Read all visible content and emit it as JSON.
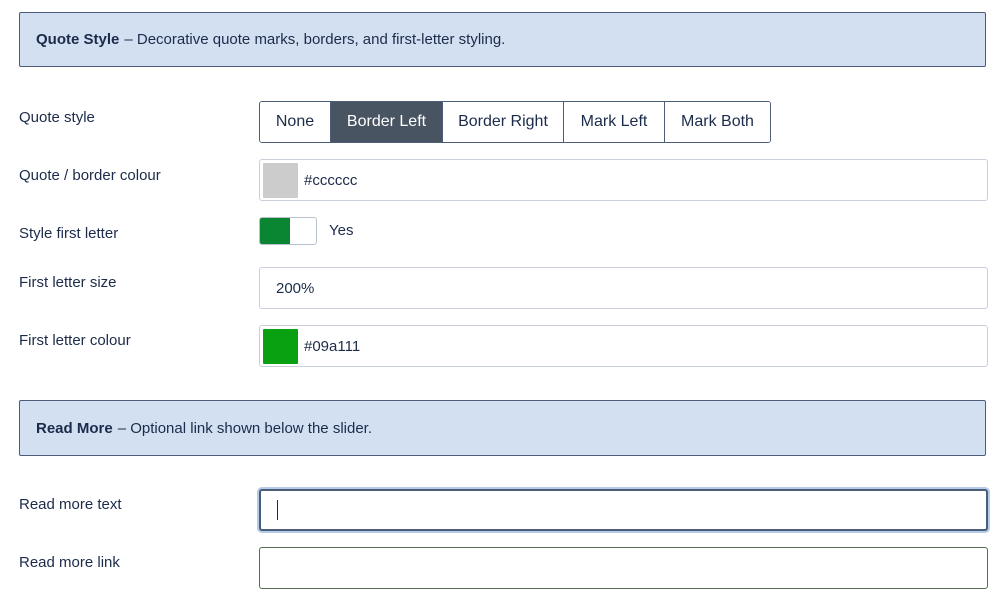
{
  "quote_section": {
    "title": "Quote Style",
    "description": "– Decorative quote marks, borders, and first-letter styling."
  },
  "quote_style": {
    "label": "Quote style",
    "options": [
      "None",
      "Border Left",
      "Border Right",
      "Mark Left",
      "Mark Both"
    ],
    "selected": "Border Left"
  },
  "border_colour": {
    "label": "Quote / border colour",
    "value": "#cccccc",
    "swatch": "#cccccc"
  },
  "first_letter_toggle": {
    "label": "Style first letter",
    "state_label": "Yes",
    "on_color": "#0a8532"
  },
  "first_letter_size": {
    "label": "First letter size",
    "value": "200%"
  },
  "first_letter_colour": {
    "label": "First letter colour",
    "value": "#09a111",
    "swatch": "#09a111"
  },
  "readmore_section": {
    "title": "Read More",
    "description": "– Optional link shown below the slider."
  },
  "read_more_text": {
    "label": "Read more text",
    "value": ""
  },
  "read_more_link": {
    "label": "Read more link",
    "value": ""
  }
}
